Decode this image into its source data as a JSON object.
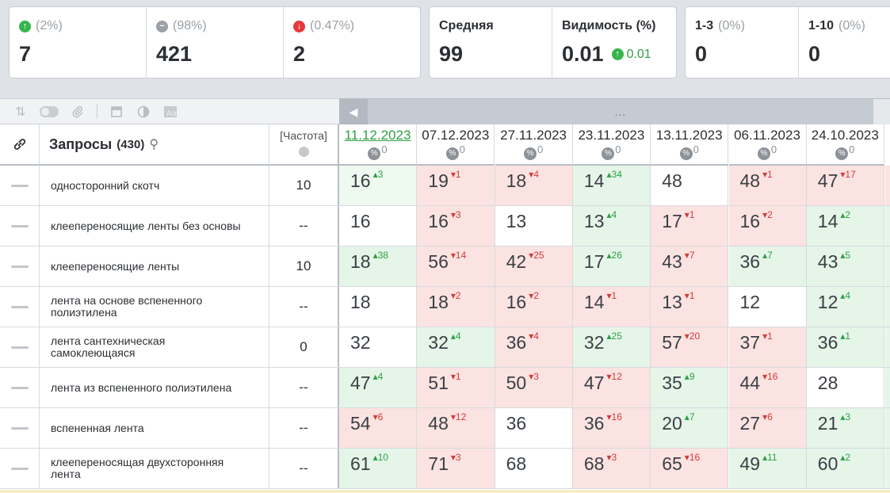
{
  "stats_positions": [
    {
      "pct": "(2%)",
      "value": "7",
      "icon": "arrow-up-icon"
    },
    {
      "pct": "(98%)",
      "value": "421",
      "icon": "no-change-icon"
    },
    {
      "pct": "(0.47%)",
      "value": "2",
      "icon": "arrow-down-icon"
    }
  ],
  "stats_avg": {
    "avg_label": "Средняя",
    "avg_value": "99",
    "vis_label": "Видимость (%)",
    "vis_value": "0.01",
    "vis_delta": "0.01"
  },
  "stats_top": [
    {
      "label": "1-3",
      "pct": "(0%)",
      "value": "0"
    },
    {
      "label": "1-10",
      "pct": "(0%)",
      "value": "0"
    }
  ],
  "scroll": {
    "left_arrow": "◀",
    "dots": "..."
  },
  "table": {
    "query_header": "Запросы",
    "query_count": "(430)",
    "freq_header": "[Частота]",
    "dates": [
      "11.12.2023",
      "07.12.2023",
      "27.11.2023",
      "23.11.2023",
      "13.11.2023",
      "06.11.2023",
      "24.10.2023"
    ],
    "date_pct": "0",
    "rows": [
      {
        "query": "односторонний скотч",
        "freq": "10",
        "cells": [
          {
            "v": "16",
            "d": "3",
            "t": "up"
          },
          {
            "v": "19",
            "d": "1",
            "t": "dn"
          },
          {
            "v": "18",
            "d": "4",
            "t": "dn"
          },
          {
            "v": "14",
            "d": "34",
            "t": "up"
          },
          {
            "v": "48",
            "d": "",
            "t": ""
          },
          {
            "v": "48",
            "d": "1",
            "t": "dn"
          },
          {
            "v": "47",
            "d": "17",
            "t": "dn"
          }
        ]
      },
      {
        "query": "клеепереносящие ленты без основы",
        "freq": "--",
        "cells": [
          {
            "v": "16",
            "d": "",
            "t": ""
          },
          {
            "v": "16",
            "d": "3",
            "t": "dn"
          },
          {
            "v": "13",
            "d": "",
            "t": ""
          },
          {
            "v": "13",
            "d": "4",
            "t": "up"
          },
          {
            "v": "17",
            "d": "1",
            "t": "dn"
          },
          {
            "v": "16",
            "d": "2",
            "t": "dn"
          },
          {
            "v": "14",
            "d": "2",
            "t": "up"
          }
        ]
      },
      {
        "query": "клеепереносящие ленты",
        "freq": "10",
        "cells": [
          {
            "v": "18",
            "d": "38",
            "t": "up"
          },
          {
            "v": "56",
            "d": "14",
            "t": "dn"
          },
          {
            "v": "42",
            "d": "25",
            "t": "dn"
          },
          {
            "v": "17",
            "d": "26",
            "t": "up"
          },
          {
            "v": "43",
            "d": "7",
            "t": "dn"
          },
          {
            "v": "36",
            "d": "7",
            "t": "up"
          },
          {
            "v": "43",
            "d": "5",
            "t": "up"
          }
        ]
      },
      {
        "query": "лента на основе вспененного полиэтилена",
        "freq": "--",
        "cells": [
          {
            "v": "18",
            "d": "",
            "t": ""
          },
          {
            "v": "18",
            "d": "2",
            "t": "dn"
          },
          {
            "v": "16",
            "d": "2",
            "t": "dn"
          },
          {
            "v": "14",
            "d": "1",
            "t": "dn"
          },
          {
            "v": "13",
            "d": "1",
            "t": "dn"
          },
          {
            "v": "12",
            "d": "",
            "t": ""
          },
          {
            "v": "12",
            "d": "4",
            "t": "up"
          }
        ]
      },
      {
        "query": "лента сантехническая самоклеющаяся",
        "freq": "0",
        "cells": [
          {
            "v": "32",
            "d": "",
            "t": ""
          },
          {
            "v": "32",
            "d": "4",
            "t": "up"
          },
          {
            "v": "36",
            "d": "4",
            "t": "dn"
          },
          {
            "v": "32",
            "d": "25",
            "t": "up"
          },
          {
            "v": "57",
            "d": "20",
            "t": "dn"
          },
          {
            "v": "37",
            "d": "1",
            "t": "dn"
          },
          {
            "v": "36",
            "d": "1",
            "t": "up"
          }
        ]
      },
      {
        "query": "лента из вспененного полиэтилена",
        "freq": "--",
        "cells": [
          {
            "v": "47",
            "d": "4",
            "t": "up"
          },
          {
            "v": "51",
            "d": "1",
            "t": "dn"
          },
          {
            "v": "50",
            "d": "3",
            "t": "dn"
          },
          {
            "v": "47",
            "d": "12",
            "t": "dn"
          },
          {
            "v": "35",
            "d": "9",
            "t": "up"
          },
          {
            "v": "44",
            "d": "16",
            "t": "dn"
          },
          {
            "v": "28",
            "d": "",
            "t": ""
          }
        ]
      },
      {
        "query": "вспененная лента",
        "freq": "--",
        "cells": [
          {
            "v": "54",
            "d": "6",
            "t": "dn"
          },
          {
            "v": "48",
            "d": "12",
            "t": "dn"
          },
          {
            "v": "36",
            "d": "",
            "t": ""
          },
          {
            "v": "36",
            "d": "16",
            "t": "dn"
          },
          {
            "v": "20",
            "d": "7",
            "t": "up"
          },
          {
            "v": "27",
            "d": "6",
            "t": "dn"
          },
          {
            "v": "21",
            "d": "3",
            "t": "up"
          }
        ]
      },
      {
        "query": "клеепереносящая двухсторонняя лента",
        "freq": "--",
        "cells": [
          {
            "v": "61",
            "d": "10",
            "t": "up"
          },
          {
            "v": "71",
            "d": "3",
            "t": "dn"
          },
          {
            "v": "68",
            "d": "",
            "t": ""
          },
          {
            "v": "68",
            "d": "3",
            "t": "dn"
          },
          {
            "v": "65",
            "d": "16",
            "t": "dn"
          },
          {
            "v": "49",
            "d": "11",
            "t": "up"
          },
          {
            "v": "60",
            "d": "2",
            "t": "up"
          }
        ]
      }
    ]
  },
  "colors": {
    "up": "#2e9e45",
    "down": "#d33a3a",
    "pos_bg": "#e5f5e8",
    "neg_bg": "#fbe3e1"
  }
}
